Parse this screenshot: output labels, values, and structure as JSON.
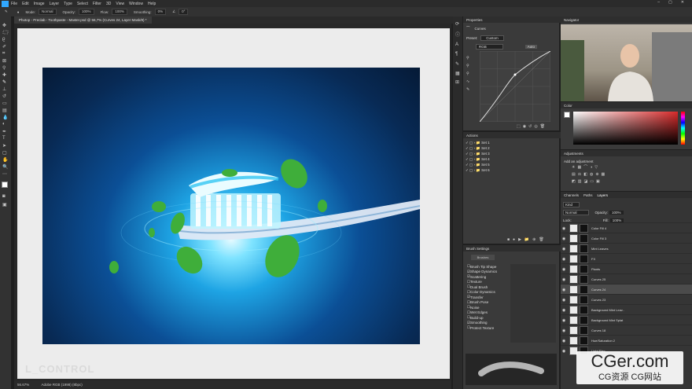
{
  "menu": [
    "File",
    "Edit",
    "Image",
    "Layer",
    "Type",
    "Select",
    "Filter",
    "3D",
    "View",
    "Window",
    "Help"
  ],
  "options": {
    "mode_label": "Mode:",
    "mode": "Normal",
    "opacity_label": "Opacity:",
    "opacity": "100%",
    "flow_label": "Flow:",
    "flow": "100%",
    "smoothing_label": "Smoothing:",
    "smoothing": "0%",
    "angle": "0°"
  },
  "document_tab": "Photop - Preclab - Toothpaste - Master.psd @ 56,7% (Curves 24, Layer Mask/8) *",
  "status": {
    "zoom": "56.67%",
    "doc_info": "Adobe RGB (1998) (8bpc)"
  },
  "watermark": "L_CONTROL",
  "properties": {
    "title": "Properties",
    "adjustment": "Curves",
    "preset_label": "Preset:",
    "preset": "Custom",
    "channel": "RGB",
    "auto": "Auto"
  },
  "navigator": {
    "title": "Navigator"
  },
  "actions": {
    "title": "Actions",
    "items": [
      "Set 1",
      "Set 2",
      "Set 3",
      "Set 4",
      "Set 5",
      "Set 6"
    ]
  },
  "color": {
    "title": "Color",
    "accent": "#d92b2b"
  },
  "adjustments": {
    "title": "Adjustments",
    "add_label": "Add an adjustment"
  },
  "layers_tabs": [
    "Channels",
    "Paths",
    "Layers"
  ],
  "layers_filter": {
    "kind": "Kind",
    "blend": "Normal",
    "opacity_label": "Opacity:",
    "opacity": "100%",
    "lock_label": "Lock:",
    "fill_label": "Fill:",
    "fill": "100%"
  },
  "layers": [
    "Color Fill 4",
    "Color Fill 3",
    "Mint Leaves",
    "FX",
    "Plants",
    "Curves 25",
    "Curves 24",
    "Curves 23",
    "Background Mint Leav..",
    "Background Mint Splat",
    "Curves 18",
    "Hue/Saturation 2",
    "Light Elec..."
  ],
  "brush_settings": {
    "title": "Brush Settings",
    "brushes_btn": "Brushes",
    "options": [
      "Brush Tip Shape",
      "Shape Dynamics",
      "Scattering",
      "Texture",
      "Dual Brush",
      "Color Dynamics",
      "Transfer",
      "Brush Pose",
      "Noise",
      "Wet Edges",
      "Build-up",
      "Smoothing",
      "Protect Texture"
    ],
    "checked": [
      false,
      true,
      true,
      false,
      false,
      false,
      true,
      false,
      false,
      false,
      false,
      true,
      false
    ]
  },
  "cger": {
    "brand": "CGer.com",
    "sub": "CG资源 CG网站"
  }
}
